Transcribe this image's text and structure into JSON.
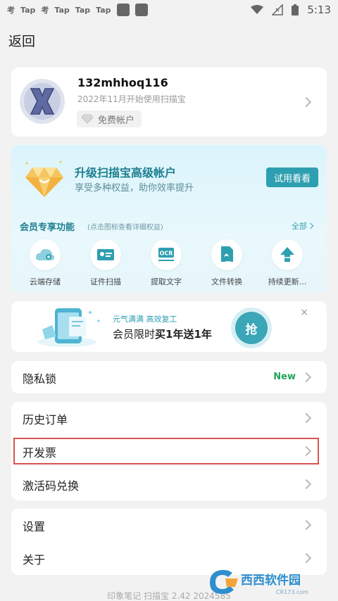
{
  "status_bar": {
    "apps": [
      "Tap",
      "Tap",
      "Tap",
      "Tap"
    ],
    "time": "5:13"
  },
  "header": {
    "back_label": "返回"
  },
  "profile": {
    "username": "132mhhoq116",
    "since": "2022年11月开始使用扫描宝",
    "plan": "免费帐户"
  },
  "premium": {
    "title": "升级扫描宝高级帐户",
    "subtitle": "享受多种权益，助你效率提升",
    "trial_button": "试用看看",
    "features_title": "会员专享功能",
    "features_hint": "(点击图标查看详细权益)",
    "features_all": "全部",
    "features": [
      {
        "label": "云端存储",
        "icon": "cloud-icon"
      },
      {
        "label": "证件扫描",
        "icon": "id-card-icon"
      },
      {
        "label": "提取文字",
        "icon": "ocr-icon"
      },
      {
        "label": "文件转换",
        "icon": "pdf-convert-icon"
      },
      {
        "label": "持续更新...",
        "icon": "upload-arrow-icon"
      }
    ],
    "colors": {
      "accent": "#2e9fb1",
      "title": "#1d7f8f"
    }
  },
  "promo": {
    "line1": "元气满满  高效复工",
    "line2_prefix": "会员限时",
    "line2_bold": "买1年送1年",
    "grab_button": "抢",
    "close": "×"
  },
  "menu": {
    "privacy_lock": "隐私锁",
    "new_badge": "New",
    "order_history": "历史订单",
    "invoice": "开发票",
    "redeem_code": "激活码兑换",
    "settings": "设置",
    "about": "关于"
  },
  "footer": {
    "version": "印象笔记 扫描宝 2.42 2024585"
  },
  "watermark": {
    "text": "西西软件园",
    "sub": "CR173.com"
  }
}
